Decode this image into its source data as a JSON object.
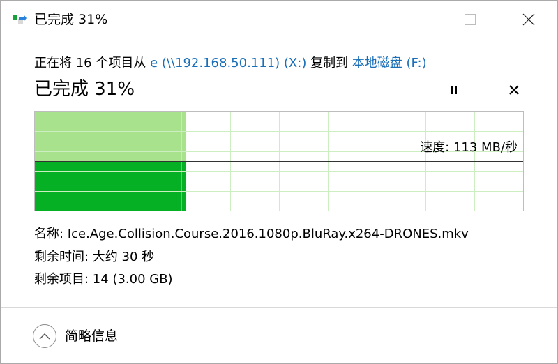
{
  "window": {
    "title": "已完成 31%",
    "icon": "file-copy-icon",
    "controls": [
      "minimize-icon",
      "maximize-icon",
      "close-icon"
    ]
  },
  "copy_info": {
    "prefix": "正在将 16 个项目从 ",
    "source": "e (\\\\192.168.50.111) (X:)",
    "middle": " 复制到 ",
    "destination": "本地磁盘 (F:)"
  },
  "status_title": "已完成 31%",
  "progress_percent": 31,
  "speed_graph": {
    "speed_label": "速度: 113 MB/秒",
    "current_speed_fraction": 0.5,
    "accent_fill": "#06b025",
    "progress_fill": "#a8e28d",
    "grid_color": "#cdeec0"
  },
  "details": {
    "name_label": "名称: ",
    "name_value": "Ice.Age.Collision.Course.2016.1080p.BluRay.x264-DRONES.mkv",
    "time_label": "剩余时间: ",
    "time_value": "大约 30 秒",
    "items_label": "剩余项目: ",
    "items_value": "14 (3.00 GB)"
  },
  "footer": {
    "toggle_label": "简略信息",
    "toggle_icon": "chevron-up-icon"
  }
}
